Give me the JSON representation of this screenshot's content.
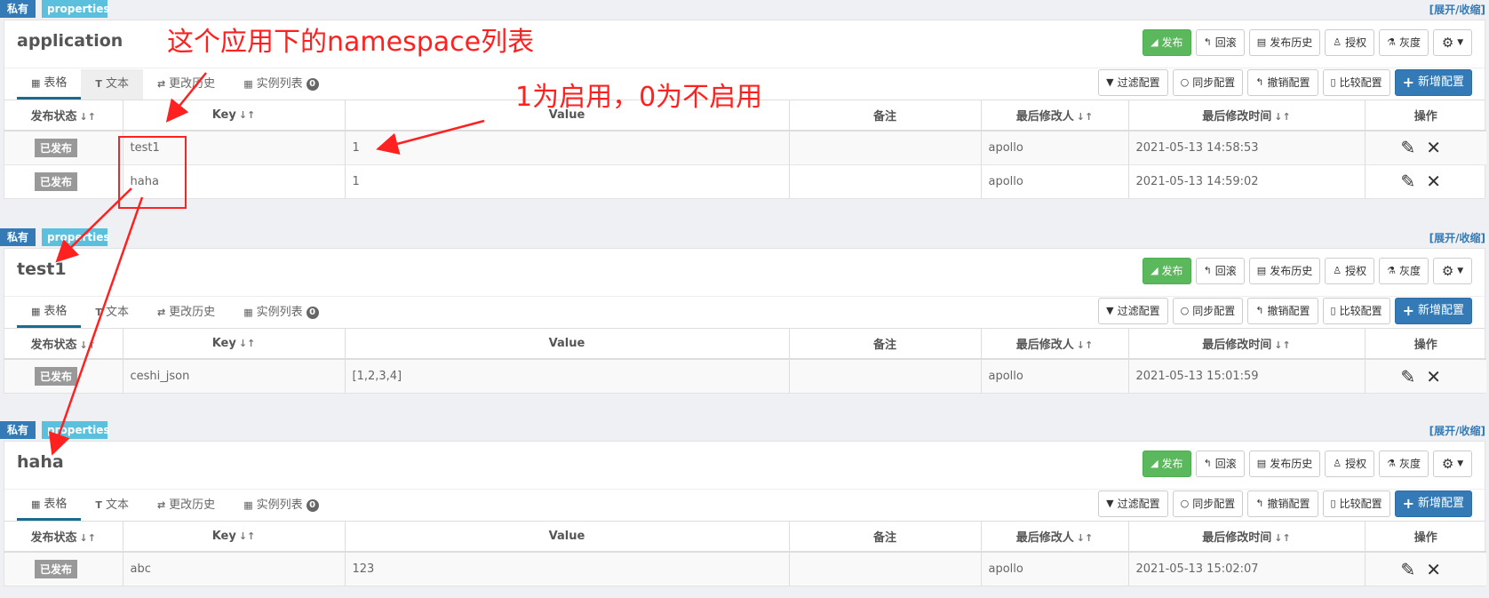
{
  "common": {
    "private_label": "私有",
    "format_label": "properties",
    "expand_label": "[展开/收缩]",
    "head_buttons": [
      "发布",
      "回滚",
      "发布历史",
      "授权",
      "灰度"
    ],
    "tabs": [
      "表格",
      "文本",
      "更改历史",
      "实例列表"
    ],
    "instance_count": "0",
    "tool_buttons": [
      "过滤配置",
      "同步配置",
      "撤销配置",
      "比较配置",
      "新增配置"
    ],
    "columns": [
      "发布状态",
      "Key",
      "Value",
      "备注",
      "最后修改人",
      "最后修改时间",
      "操作"
    ]
  },
  "namespaces": [
    {
      "name": "application",
      "rows": [
        {
          "status": "已发布",
          "key": "test1",
          "value": "1",
          "comment": "",
          "modifier": "apollo",
          "time": "2021-05-13 14:58:53"
        },
        {
          "status": "已发布",
          "key": "haha",
          "value": "1",
          "comment": "",
          "modifier": "apollo",
          "time": "2021-05-13 14:59:02"
        }
      ]
    },
    {
      "name": "test1",
      "rows": [
        {
          "status": "已发布",
          "key": "ceshi_json",
          "value": "[1,2,3,4]",
          "comment": "",
          "modifier": "apollo",
          "time": "2021-05-13 15:01:59"
        }
      ]
    },
    {
      "name": "haha",
      "rows": [
        {
          "status": "已发布",
          "key": "abc",
          "value": "123",
          "comment": "",
          "modifier": "apollo",
          "time": "2021-05-13 15:02:07"
        }
      ]
    }
  ],
  "annotations": {
    "namespace_list": "这个应用下的namespace列表",
    "enable_note": "1为启用，0为不启用"
  },
  "colors": {
    "primary": "#337ab7",
    "success": "#5cb85c",
    "info": "#5bc0de",
    "annotation": "#ff2020"
  }
}
